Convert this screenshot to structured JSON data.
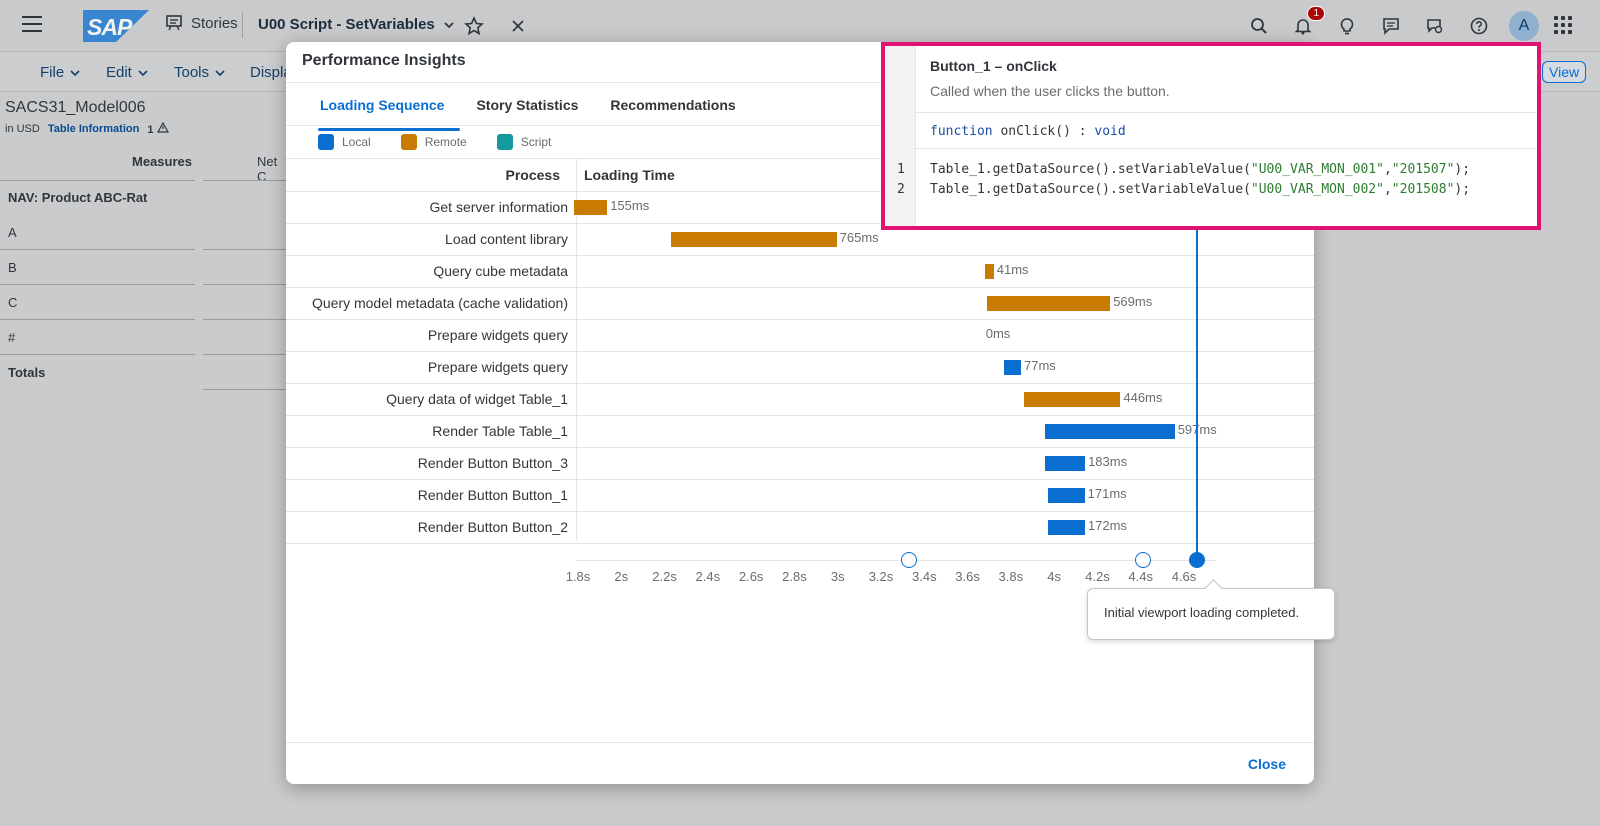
{
  "shell": {
    "logo": "SAP",
    "stories_label": "Stories",
    "story_title": "U00 Script - SetVariables",
    "notification_count": "1",
    "avatar_initial": "A"
  },
  "toolbar": {
    "menus": [
      "File",
      "Edit",
      "Tools",
      "Displa"
    ],
    "view_label": "View"
  },
  "background_table": {
    "model_name": "SACS31_Model006",
    "currency": "in USD",
    "table_info": "Table Information",
    "warning_count": "1",
    "col_measures": "Measures",
    "col_net": "Net C",
    "group_label": "NAV: Product ABC-Rat",
    "rows": [
      "A",
      "B",
      "C",
      "#"
    ],
    "totals": "Totals"
  },
  "dialog": {
    "title": "Performance Insights",
    "tabs": [
      "Loading Sequence",
      "Story Statistics",
      "Recommendations"
    ],
    "legend": [
      {
        "label": "Local",
        "color": "#0a6ed1"
      },
      {
        "label": "Remote",
        "color": "#c87b00"
      },
      {
        "label": "Script",
        "color": "#14999e"
      }
    ],
    "col_process": "Process",
    "col_loading_time": "Loading Time",
    "tooltip": "Initial viewport loading completed.",
    "close_label": "Close"
  },
  "chart_data": {
    "type": "gantt",
    "x_unit": "s",
    "xlim": [
      1.8,
      4.6
    ],
    "ticks": [
      "1.8s",
      "2s",
      "2.2s",
      "2.4s",
      "2.6s",
      "2.8s",
      "3s",
      "3.2s",
      "3.4s",
      "3.6s",
      "3.8s",
      "4s",
      "4.2s",
      "4.4s",
      "4.6s"
    ],
    "rows": [
      {
        "process": "Get server information",
        "start": 1.78,
        "duration_ms": 155,
        "label": "155ms",
        "kind": "Remote"
      },
      {
        "process": "Load content library",
        "start": 2.23,
        "duration_ms": 765,
        "label": "765ms",
        "kind": "Remote"
      },
      {
        "process": "Query cube metadata",
        "start": 3.68,
        "duration_ms": 41,
        "label": "41ms",
        "kind": "Remote"
      },
      {
        "process": "Query model metadata (cache validation)",
        "start": 3.69,
        "duration_ms": 569,
        "label": "569ms",
        "kind": "Remote"
      },
      {
        "process": "Prepare widgets query",
        "start": 3.67,
        "duration_ms": 0,
        "label": "0ms",
        "kind": "Local"
      },
      {
        "process": "Prepare widgets query",
        "start": 3.77,
        "duration_ms": 77,
        "label": "77ms",
        "kind": "Local"
      },
      {
        "process": "Query data of widget Table_1",
        "start": 3.86,
        "duration_ms": 446,
        "label": "446ms",
        "kind": "Remote"
      },
      {
        "process": "Render Table Table_1",
        "start": 3.96,
        "duration_ms": 597,
        "label": "597ms",
        "kind": "Local"
      },
      {
        "process": "Render Button Button_3",
        "start": 3.96,
        "duration_ms": 183,
        "label": "183ms",
        "kind": "Local"
      },
      {
        "process": "Render Button Button_1",
        "start": 3.97,
        "duration_ms": 171,
        "label": "171ms",
        "kind": "Local"
      },
      {
        "process": "Render Button Button_2",
        "start": 3.97,
        "duration_ms": 172,
        "label": "172ms",
        "kind": "Local"
      }
    ],
    "markers": [
      {
        "time": 3.33,
        "filled": false
      },
      {
        "time": 4.41,
        "filled": false
      },
      {
        "time": 4.66,
        "filled": true
      }
    ]
  },
  "code_popover": {
    "title": "Button_1 – onClick",
    "description": "Called when the user clicks the button.",
    "signature_kw": "function",
    "signature_name": "onClick() : ",
    "signature_type": "void",
    "lines": [
      {
        "num": "1",
        "prefix": "Table_1.getDataSource().setVariableValue(",
        "arg1": "\"U00_VAR_MON_001\"",
        "sep": ",",
        "arg2": "\"201507\"",
        "suffix": ");"
      },
      {
        "num": "2",
        "prefix": "Table_1.getDataSource().setVariableValue(",
        "arg1": "\"U00_VAR_MON_002\"",
        "sep": ",",
        "arg2": "\"201508\"",
        "suffix": ");"
      }
    ]
  }
}
